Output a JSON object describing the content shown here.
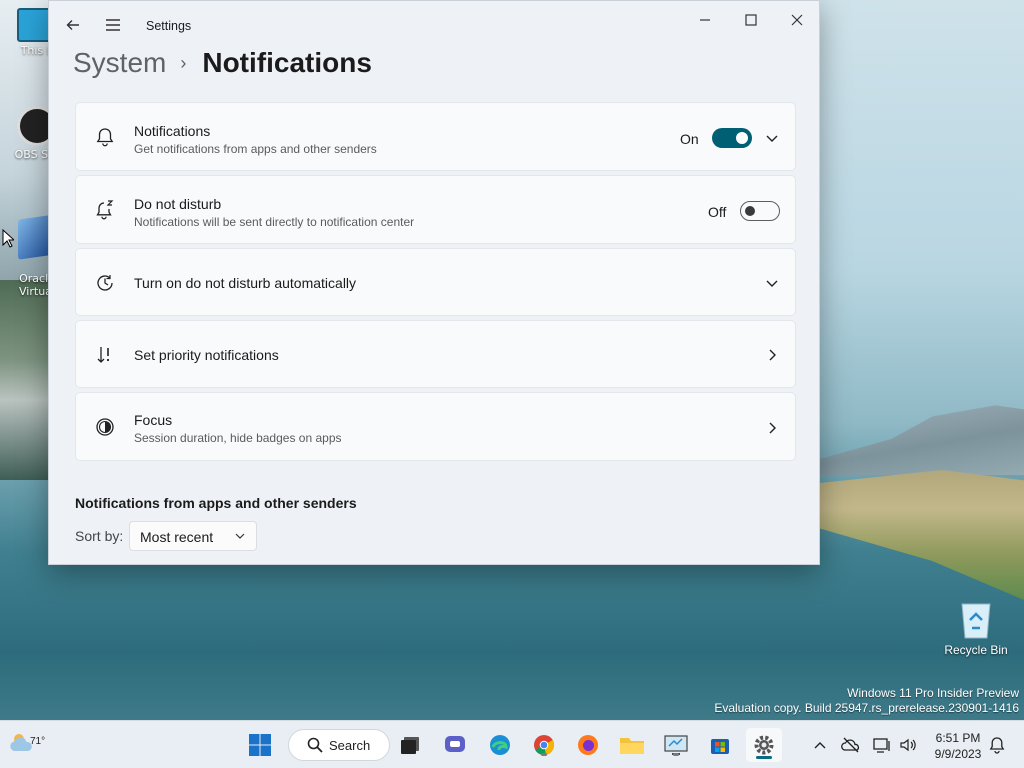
{
  "desktop": {
    "icons": [
      {
        "label": "This P"
      },
      {
        "label": "OBS Stu"
      },
      {
        "label": "Oracle\nVirtual"
      }
    ],
    "recycle_bin": "Recycle Bin",
    "watermark_line1": "Windows 11 Pro Insider Preview",
    "watermark_line2": "Evaluation copy. Build 25947.rs_prerelease.230901-1416"
  },
  "window": {
    "app_title": "Settings",
    "breadcrumb_parent": "System",
    "breadcrumb_separator": "›",
    "page_title": "Notifications",
    "cards": [
      {
        "title": "Notifications",
        "subtitle": "Get notifications from apps and other senders",
        "state": "On",
        "toggle": true,
        "icon": "bell-icon"
      },
      {
        "title": "Do not disturb",
        "subtitle": "Notifications will be sent directly to notification center",
        "state": "Off",
        "toggle": false,
        "icon": "bell-snooze-icon"
      },
      {
        "title": "Turn on do not disturb automatically",
        "icon": "clock-icon"
      },
      {
        "title": "Set priority notifications",
        "icon": "sort-priority-icon"
      },
      {
        "title": "Focus",
        "subtitle": "Session duration, hide badges on apps",
        "icon": "focus-icon"
      }
    ],
    "section_title": "Notifications from apps and other senders",
    "sort_label": "Sort by:",
    "sort_value": "Most recent"
  },
  "taskbar": {
    "temperature": "71°",
    "search_label": "Search",
    "time": "6:51 PM",
    "date": "9/9/2023",
    "accent_color": "#005f73"
  }
}
